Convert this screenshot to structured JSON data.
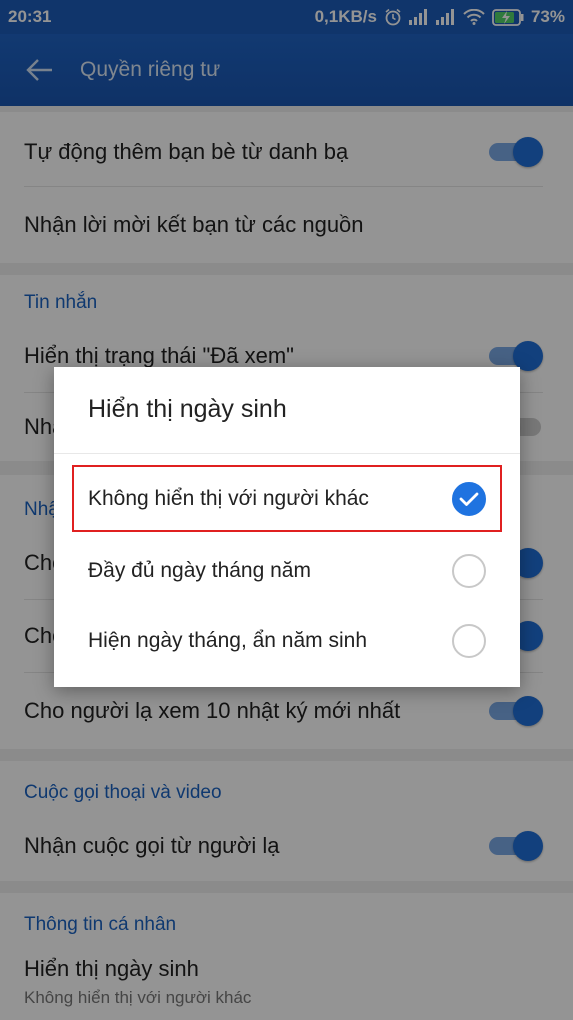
{
  "status_bar": {
    "time": "20:31",
    "network_speed": "0,1KB/s",
    "battery": "73%",
    "icons": [
      "alarm-icon",
      "signal-icon",
      "signal-icon",
      "wifi-icon",
      "battery-charging-icon"
    ]
  },
  "app_bar": {
    "title": "Quyền riêng tư",
    "back_icon": "arrow-left-icon"
  },
  "settings": {
    "auto_add_contacts": {
      "label": "Tự động thêm bạn bè từ danh bạ",
      "toggle": "on"
    },
    "receive_invites": {
      "label": "Nhận lời mời kết bạn từ các nguồn"
    },
    "section_messages": "Tin nhắn",
    "seen_status": {
      "label": "Hiển thị trạng thái \"Đã xem\"",
      "toggle": "on"
    },
    "row_nh_partial": {
      "label": "Nhậ",
      "toggle": "off"
    },
    "section_nh_partial": "Nhậ",
    "row_cho_1": {
      "label": "Cho",
      "toggle": "on"
    },
    "row_cho_2": {
      "label": "Cho",
      "toggle": "on"
    },
    "strangers_diary": {
      "label": "Cho người lạ xem 10 nhật ký mới nhất",
      "toggle": "on"
    },
    "section_calls": "Cuộc gọi thoại và video",
    "calls_from_strangers": {
      "label": "Nhận cuộc gọi từ người lạ",
      "toggle": "on"
    },
    "section_personal": "Thông tin cá nhân",
    "birthday": {
      "label": "Hiển thị ngày sinh",
      "value": "Không hiển thị với người khác"
    }
  },
  "dialog": {
    "title": "Hiển thị ngày sinh",
    "options": [
      {
        "label": "Không hiển thị với người khác",
        "selected": true
      },
      {
        "label": "Đầy đủ ngày tháng năm",
        "selected": false
      },
      {
        "label": "Hiện ngày tháng, ẩn năm sinh",
        "selected": false
      }
    ]
  },
  "colors": {
    "app_bar": "#1c5cb8",
    "accent": "#1f73e0",
    "section_header": "#1b62c1",
    "highlight_border": "#e02020"
  }
}
